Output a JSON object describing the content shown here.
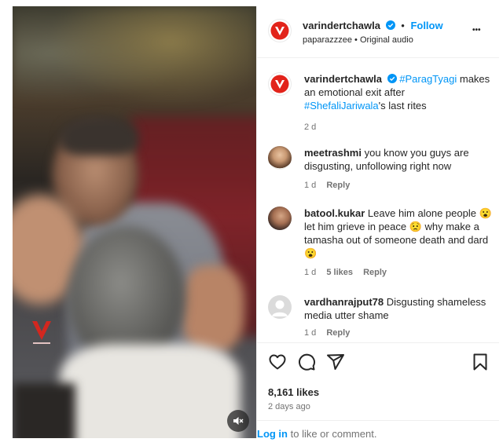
{
  "post": {
    "author": "varindertchawla",
    "follow_label": "Follow",
    "dot": "•",
    "subline": "paparazzzee • Original audio",
    "more_label": "•••"
  },
  "caption": {
    "author": "varindertchawla",
    "hashtag1": "#ParagTyagi",
    "text1": " makes an emotional exit after",
    "hashtag2": "#ShefaliJariwala",
    "text2": "'s last rites",
    "time": "2 d"
  },
  "comments": [
    {
      "user": "meetrashmi",
      "text": " you know you guys are disgusting, unfollowing right now",
      "time": "1 d",
      "likes": "",
      "reply": "Reply"
    },
    {
      "user": "batool.kukar",
      "text": " Leave him alone people 😮 let him grieve in peace 😟 why make a tamasha out of someone death and dard 😮",
      "time": "1 d",
      "likes": "5 likes",
      "reply": "Reply"
    },
    {
      "user": "vardhanrajput78",
      "text": " Disgusting shameless media utter shame",
      "time": "1 d",
      "likes": "",
      "reply": "Reply"
    }
  ],
  "actions": {
    "likes": "8,161 likes",
    "time_ago": "2 days ago",
    "login_link": "Log in",
    "login_rest": " to like or comment."
  },
  "icons": {
    "like": "heart-icon",
    "comment": "comment-icon",
    "share": "share-icon",
    "save": "bookmark-icon",
    "mute": "speaker-muted-icon",
    "verified": "verified-badge-icon",
    "brand_accent": "#e2231a"
  }
}
